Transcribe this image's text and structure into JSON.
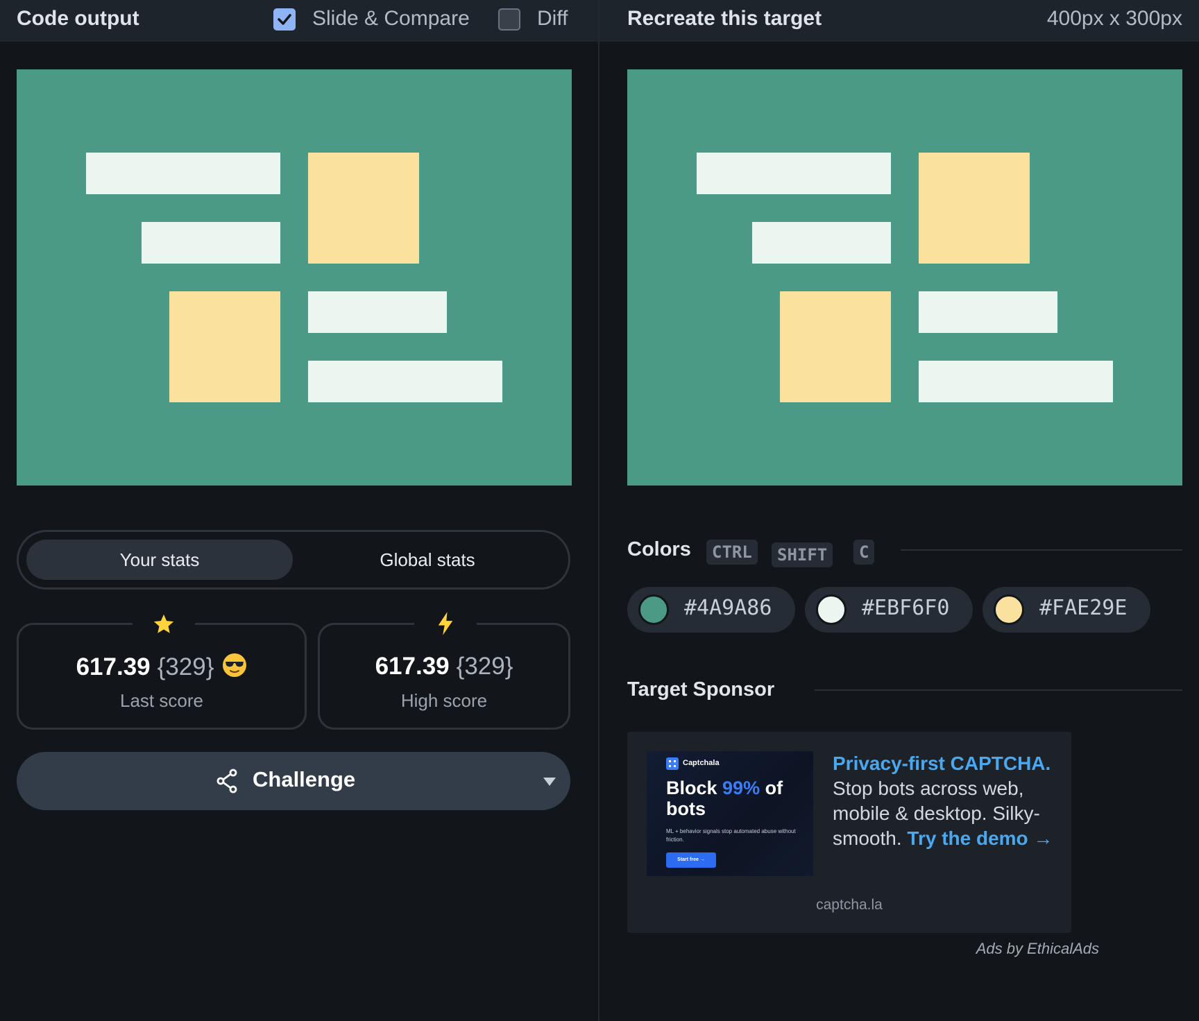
{
  "left": {
    "title": "Code output",
    "slide_compare": {
      "label": "Slide & Compare",
      "checked": true
    },
    "diff": {
      "label": "Diff",
      "checked": false
    },
    "stats_tabs": [
      "Your stats",
      "Global stats"
    ],
    "last_score": {
      "value": "617.39",
      "count": "{329}",
      "label": "Last score",
      "icon": "star-icon",
      "emoji": "sunglasses-emoji"
    },
    "high_score": {
      "value": "617.39",
      "count": "{329}",
      "label": "High score",
      "icon": "lightning-icon"
    },
    "challenge": {
      "label": "Challenge",
      "icon": "share-icon",
      "menu_icon": "caret-down-icon"
    }
  },
  "right": {
    "title": "Recreate this target",
    "dimensions": "400px x 300px",
    "colors_title": "Colors",
    "shortcut_keys": [
      "CTRL",
      "SHIFT",
      "C"
    ],
    "swatches": [
      "#4A9A86",
      "#EBF6F0",
      "#FAE29E"
    ],
    "sponsor_title": "Target Sponsor",
    "ad": {
      "brand": "Captchala",
      "headline_pre": "Block ",
      "headline_highlight": "99%",
      "headline_post": " of bots",
      "small_text": "ML + behavior signals stop automated abuse without friction.",
      "button_label": "Start free →",
      "copy_strong": "Privacy-first CAPTCHA.",
      "copy_body": " Stop bots across web, mobile & desktop. Silky-smooth. ",
      "copy_link": "Try the demo →",
      "domain": "captcha.la"
    },
    "attribution": "Ads by EthicalAds"
  },
  "colors": {
    "background": "#4A9A86",
    "light": "#EBF6F0",
    "yellow": "#FAE29E",
    "accent_blue": "#4aa8f0"
  }
}
